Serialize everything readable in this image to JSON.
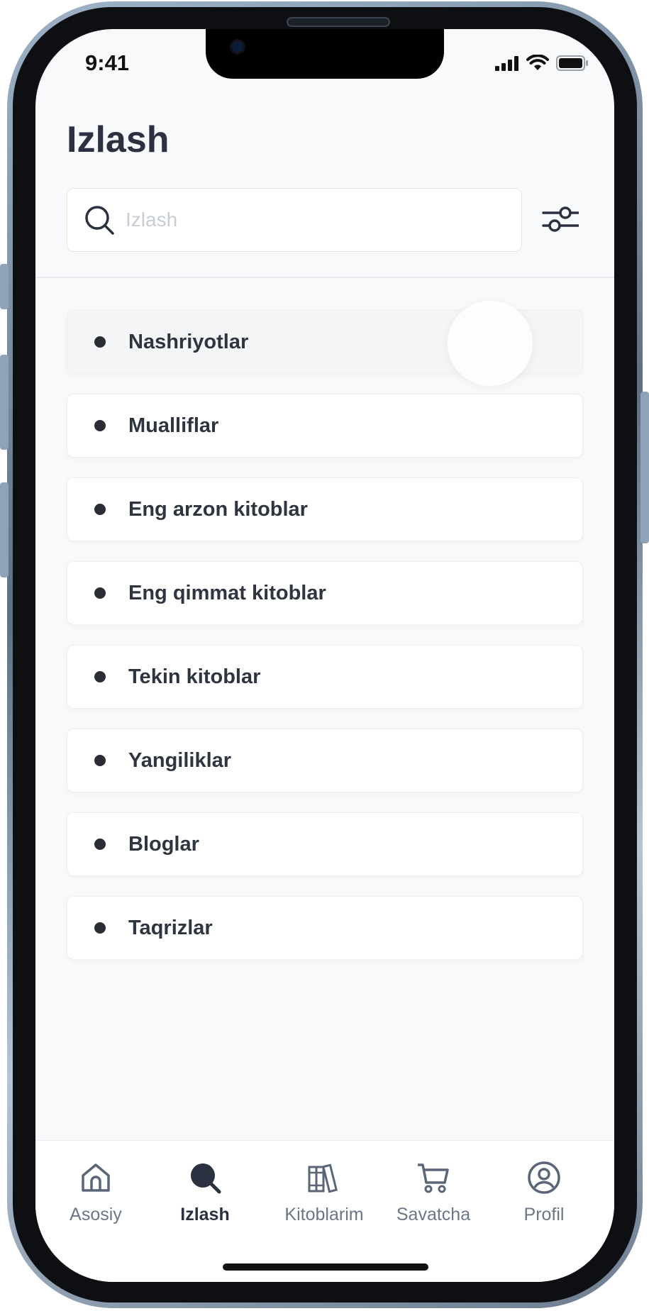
{
  "status_bar": {
    "time": "9:41",
    "icons": [
      "cellular-signal-icon",
      "wifi-icon",
      "battery-icon"
    ]
  },
  "header": {
    "title": "Izlash"
  },
  "search": {
    "placeholder": "Izlash",
    "value": "",
    "icon": "search-icon",
    "filter_icon": "filter-sliders-icon"
  },
  "categories": [
    {
      "label": "Nashriyotlar",
      "pressed": true
    },
    {
      "label": "Mualliflar"
    },
    {
      "label": "Eng arzon kitoblar"
    },
    {
      "label": "Eng qimmat kitoblar"
    },
    {
      "label": "Tekin kitoblar"
    },
    {
      "label": "Yangiliklar"
    },
    {
      "label": "Bloglar"
    },
    {
      "label": "Taqrizlar"
    }
  ],
  "tab_bar": {
    "active": "Izlash",
    "tabs": [
      {
        "label": "Asosiy",
        "icon": "home-icon"
      },
      {
        "label": "Izlash",
        "icon": "search-icon"
      },
      {
        "label": "Kitoblarim",
        "icon": "books-icon"
      },
      {
        "label": "Savatcha",
        "icon": "cart-icon"
      },
      {
        "label": "Profil",
        "icon": "profile-icon"
      }
    ]
  },
  "colors": {
    "background": "#f8f9fb",
    "title": "#2b3140",
    "text": "#2f3540",
    "muted": "#6c7686",
    "placeholder": "#c8ccd3",
    "border": "#eceef2"
  }
}
